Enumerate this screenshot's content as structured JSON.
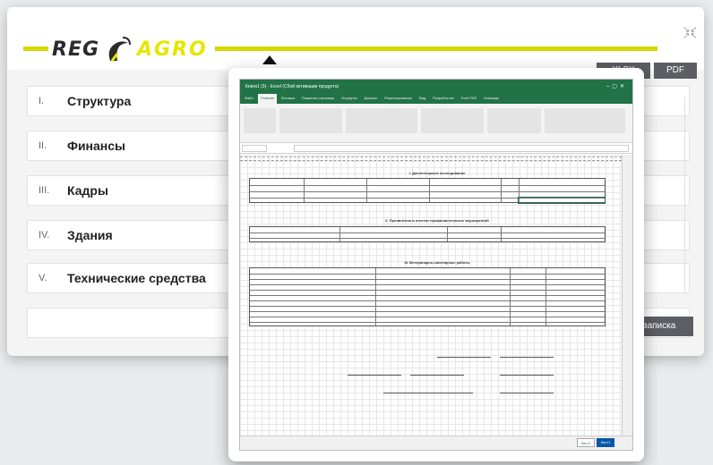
{
  "header": {
    "logo_left": "REG",
    "logo_right": "AGRO",
    "export_xlsx": "XLSX",
    "export_pdf": "PDF"
  },
  "sections": [
    {
      "num": "I.",
      "title": "Структура"
    },
    {
      "num": "II.",
      "title": "Финансы"
    },
    {
      "num": "III.",
      "title": "Кадры"
    },
    {
      "num": "IV.",
      "title": "Здания"
    },
    {
      "num": "V.",
      "title": "Технические средства"
    }
  ],
  "save_button": "записка",
  "colors": {
    "brand_yellow": "#e6e600",
    "button_dark": "#5b5e63",
    "excel_green": "#217346"
  },
  "excel": {
    "title": "Книга1 (3) - Excel (Сбой активации продукта)",
    "tabs": [
      "Файл",
      "Главная",
      "Вставка",
      "Разметка страницы",
      "Формулы",
      "Данные",
      "Рецензирование",
      "Вид",
      "Разработчик",
      "Foxit PDF",
      "Команда"
    ],
    "section1": "I. Диспетчерское исследование",
    "section2": "II. Проявления в отчетах профилактических мероприятий",
    "section3": "III. Ветеринарно-санитарные работы",
    "sheet_tabs": [
      "Лист1",
      "Лист1"
    ]
  }
}
